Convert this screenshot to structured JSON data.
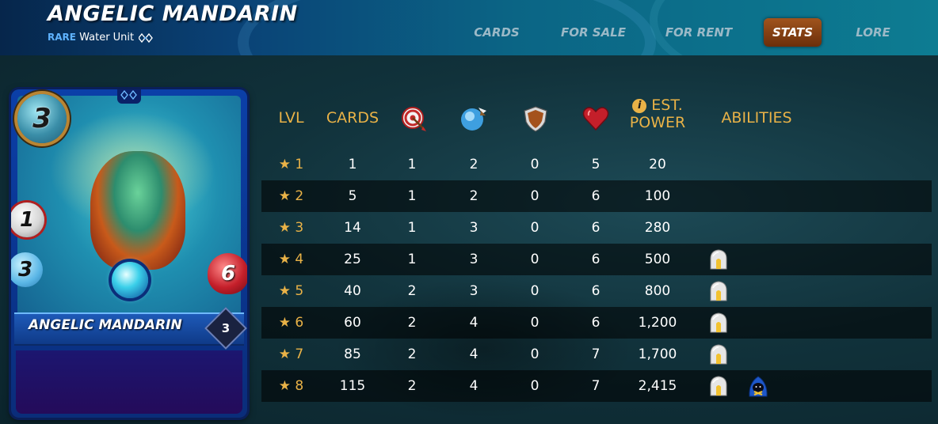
{
  "header": {
    "title": "ANGELIC MANDARIN",
    "rarity": "RARE",
    "element_text": "Water Unit",
    "element_icon": "water-element-icon"
  },
  "nav": {
    "tabs": [
      {
        "label": "CARDS",
        "active": false
      },
      {
        "label": "FOR SALE",
        "active": false
      },
      {
        "label": "FOR RENT",
        "active": false
      },
      {
        "label": "STATS",
        "active": true
      },
      {
        "label": "LORE",
        "active": false
      }
    ]
  },
  "card": {
    "name": "ANGELIC MANDARIN",
    "level": "3",
    "mana": "3",
    "ranged": "1",
    "speed": "3",
    "health": "6"
  },
  "table": {
    "headers": {
      "lvl": "LVL",
      "cards": "CARDS",
      "ranged_icon": "ranged-attack-icon",
      "speed_icon": "speed-icon",
      "armor_icon": "armor-shield-icon",
      "health_icon": "health-heart-icon",
      "power_info": "i",
      "power_line1": "EST.",
      "power_line2": "POWER",
      "abilities": "ABILITIES"
    },
    "rows": [
      {
        "lvl": "★ 1",
        "cards": "1",
        "ranged": "1",
        "speed": "2",
        "armor": "0",
        "health": "5",
        "power": "20",
        "abilities": []
      },
      {
        "lvl": "★ 2",
        "cards": "5",
        "ranged": "1",
        "speed": "2",
        "armor": "0",
        "health": "6",
        "power": "100",
        "abilities": []
      },
      {
        "lvl": "★ 3",
        "cards": "14",
        "ranged": "1",
        "speed": "3",
        "armor": "0",
        "health": "6",
        "power": "280",
        "abilities": []
      },
      {
        "lvl": "★ 4",
        "cards": "25",
        "ranged": "1",
        "speed": "3",
        "armor": "0",
        "health": "6",
        "power": "500",
        "abilities": [
          "shield-dome-ability-icon"
        ]
      },
      {
        "lvl": "★ 5",
        "cards": "40",
        "ranged": "2",
        "speed": "3",
        "armor": "0",
        "health": "6",
        "power": "800",
        "abilities": [
          "shield-dome-ability-icon"
        ]
      },
      {
        "lvl": "★ 6",
        "cards": "60",
        "ranged": "2",
        "speed": "4",
        "armor": "0",
        "health": "6",
        "power": "1,200",
        "abilities": [
          "shield-dome-ability-icon"
        ]
      },
      {
        "lvl": "★ 7",
        "cards": "85",
        "ranged": "2",
        "speed": "4",
        "armor": "0",
        "health": "7",
        "power": "1,700",
        "abilities": [
          "shield-dome-ability-icon"
        ]
      },
      {
        "lvl": "★ 8",
        "cards": "115",
        "ranged": "2",
        "speed": "4",
        "armor": "0",
        "health": "7",
        "power": "2,415",
        "abilities": [
          "shield-dome-ability-icon",
          "hooded-cleanse-ability-icon"
        ]
      }
    ]
  }
}
